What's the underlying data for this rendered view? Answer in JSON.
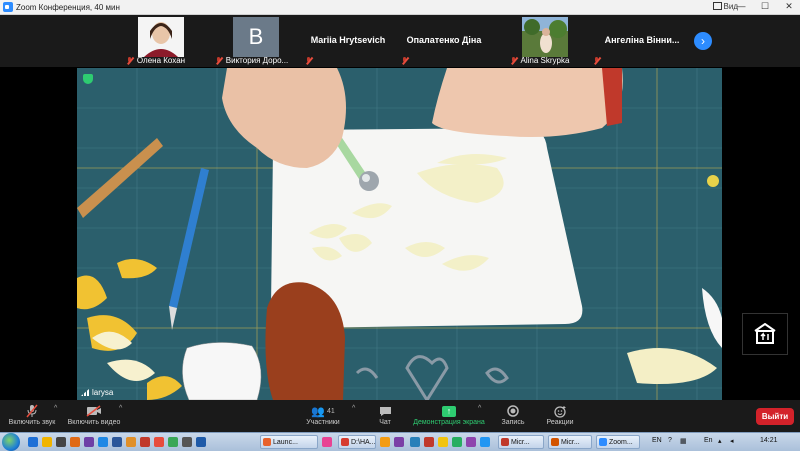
{
  "window": {
    "title": "Zoom Конференция, 40 мин",
    "view_label": "Вид",
    "controls": [
      "—",
      "☐",
      "✕"
    ]
  },
  "participants": [
    {
      "name": "Олена Кохан",
      "muted": true,
      "type": "photo"
    },
    {
      "name": "Виктория Доро...",
      "muted": true,
      "type": "avatar",
      "initial": "B"
    },
    {
      "name": "Mariia Hrytsevich",
      "muted": true,
      "type": "name"
    },
    {
      "name": "Опалатенко Діна",
      "muted": true,
      "type": "name"
    },
    {
      "name": "Alina Skrypka",
      "muted": true,
      "type": "photo"
    },
    {
      "name": "Ангеліна Вінни...",
      "muted": true,
      "type": "name"
    }
  ],
  "main_video": {
    "speaker": "larysa"
  },
  "toolbar": {
    "unmute": "Включить звук",
    "start_video": "Включить видео",
    "participants": "Участники",
    "participants_count": "41",
    "chat": "Чат",
    "share_screen": "Демонстрация экрана",
    "record": "Запись",
    "reactions": "Реакции",
    "leave": "Выйти"
  },
  "taskbar": {
    "tasks": [
      {
        "label": "Launc...",
        "color": "#e8622c"
      },
      {
        "label": "D:\\HA...",
        "color": "#d63b2f"
      },
      {
        "label": "Micr...",
        "color": "#c0392b"
      },
      {
        "label": "Micr...",
        "color": "#d35400"
      },
      {
        "label": "Zoom...",
        "color": "#2d8cff"
      }
    ],
    "lang1": "EN",
    "lang2": "En",
    "time": "14:21"
  },
  "colors": {
    "accent": "#2d8cff",
    "leave": "#d3222a",
    "share": "#2ecc71",
    "mat": "#2a5d6a"
  }
}
